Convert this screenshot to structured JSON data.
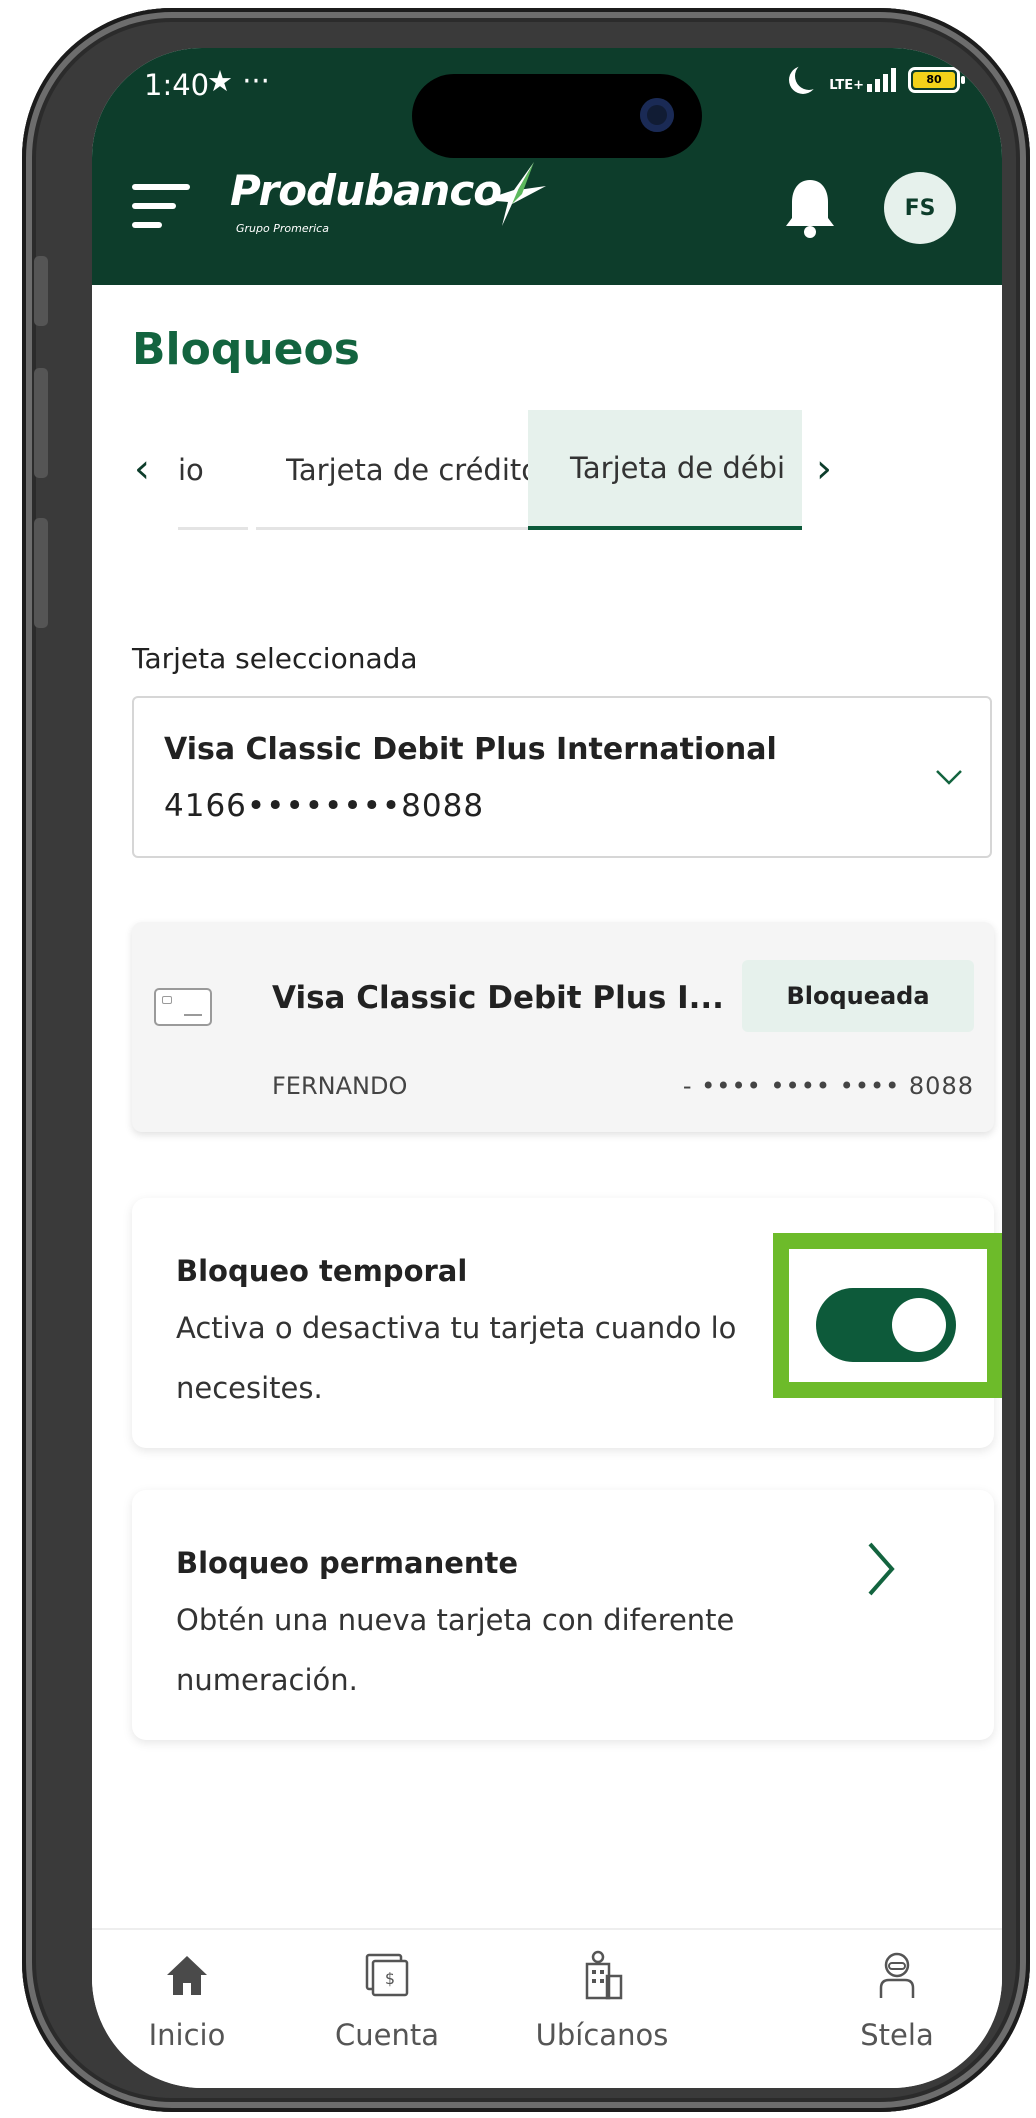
{
  "status_bar": {
    "time": "1:40",
    "extra": "★ ···",
    "network": "LTE+",
    "battery": "80"
  },
  "header": {
    "logo_text": "Produbanco",
    "logo_subtitle": "Grupo Promerica",
    "avatar_initials": "FS",
    "brand_color": "#0d3d2b"
  },
  "page": {
    "title": "Bloqueos"
  },
  "tabs": [
    {
      "label": "io",
      "active": false
    },
    {
      "label": "Tarjeta de crédito",
      "active": false
    },
    {
      "label": "Tarjeta de débi",
      "active": true
    }
  ],
  "card_select": {
    "label": "Tarjeta seleccionada",
    "selected_name": "Visa Classic Debit Plus International",
    "selected_number": "4166••••••••8088"
  },
  "card_summary": {
    "name": "Visa Classic Debit Plus I...",
    "status": "Bloqueada",
    "holder": "FERNANDO",
    "masked_number": "- •••• •••• •••• 8088"
  },
  "temporary_block": {
    "title": "Bloqueo temporal",
    "description": "Activa o desactiva tu tarjeta cuando lo necesites.",
    "enabled": true
  },
  "permanent_block": {
    "title": "Bloqueo permanente",
    "description": "Obtén una nueva tarjeta con diferente numeración."
  },
  "bottom_nav": [
    {
      "label": "Inicio",
      "icon": "home-icon"
    },
    {
      "label": "Cuenta",
      "icon": "money-icon"
    },
    {
      "label": "Ubícanos",
      "icon": "building-icon"
    },
    {
      "label": "Stela",
      "icon": "assistant-icon"
    }
  ],
  "colors": {
    "accent": "#13643f",
    "active_tab_bg": "#e6f1ec",
    "highlight": "#6dbb2a"
  }
}
